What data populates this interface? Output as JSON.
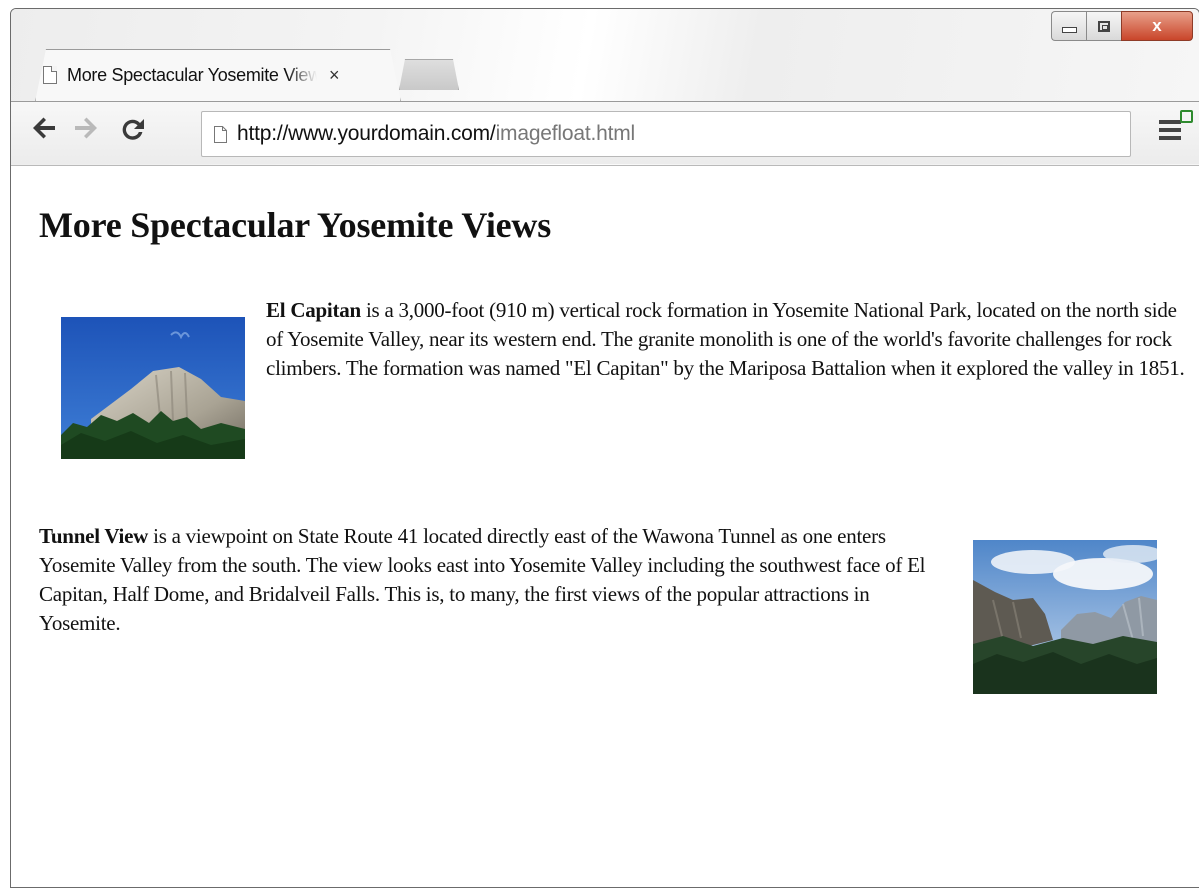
{
  "browser": {
    "tab_title": "More Spectacular Yosemite Views",
    "tab_close": "×",
    "url_host": "http://www.yourdomain.com/",
    "url_path": "imagefloat.html",
    "window_close": "x"
  },
  "page": {
    "heading": "More Spectacular Yosemite Views",
    "p1_bold": "El Capitan",
    "p1_text": " is a 3,000-foot (910 m) vertical rock formation in Yosemite National Park, located on the north side of Yosemite Valley, near its western end. The granite monolith is one of the world's favorite challenges for rock climbers. The formation was named \"El Capitan\" by the Mariposa Battalion when it explored the valley in 1851.",
    "p2_bold": "Tunnel View",
    "p2_text": " is a viewpoint on State Route 41 located directly east of the Wawona Tunnel as one enters Yosemite Valley from the south. The view looks east into Yosemite Valley including the southwest face of El Capitan, Half Dome, and Bridalveil Falls. This is, to many, the first views of the popular attractions in Yosemite."
  }
}
